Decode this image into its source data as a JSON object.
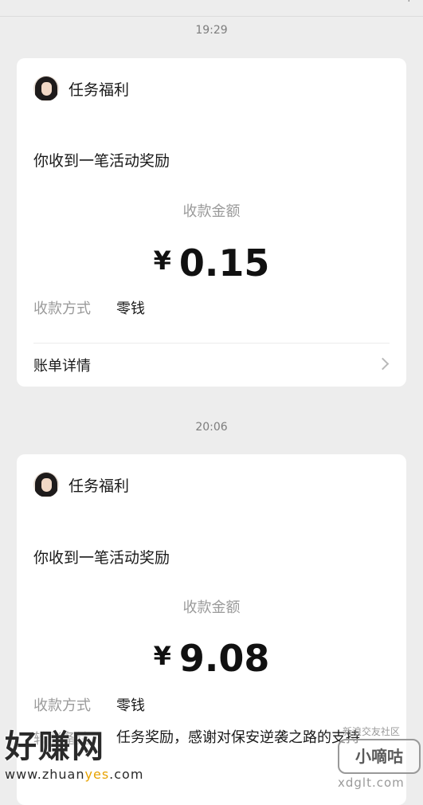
{
  "top_bar": {
    "partial_icon": "⌐"
  },
  "messages": [
    {
      "timestamp": "19:29",
      "sender": "任务福利",
      "title": "你收到一笔活动奖励",
      "amount_label": "收款金额",
      "currency": "¥",
      "amount": "0.15",
      "method_label": "收款方式",
      "method_value": "零钱",
      "details_label": "账单详情"
    },
    {
      "timestamp": "20:06",
      "sender": "任务福利",
      "title": "你收到一笔活动奖励",
      "amount_label": "收款金额",
      "currency": "¥",
      "amount": "9.08",
      "method_label": "收款方式",
      "method_value": "零钱",
      "remark_label": "转账备注",
      "remark_value": "任务奖励，感谢对保安逆袭之路的支持"
    }
  ],
  "watermarks": {
    "left_title": "好赚网",
    "left_url_prefix": "www.zhuan",
    "left_url_highlight": "yes",
    "left_url_suffix": ".com",
    "right_top": "新浪交友社区",
    "right_badge": "小嘀咕",
    "right_url": "xdglt.com"
  }
}
